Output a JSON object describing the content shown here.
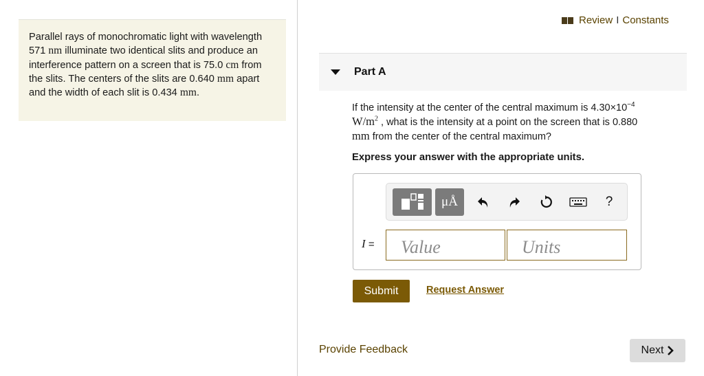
{
  "problem": {
    "seg1": "Parallel rays of monochromatic light with wavelength 571 ",
    "unit_nm": "nm",
    "seg2": " illuminate two identical slits and produce an interference pattern on a screen that is 75.0 ",
    "unit_cm": "cm",
    "seg3": " from the slits. The centers of the slits are 0.640 ",
    "unit_mm1": "mm",
    "seg4": " apart and the width of each slit is 0.434 ",
    "unit_mm2": "mm",
    "seg5": "."
  },
  "header": {
    "review": "Review",
    "separator": "I",
    "constants": "Constants"
  },
  "part": {
    "title": "Part A"
  },
  "question": {
    "q1": "If the intensity at the center of the central maximum is 4.30×10",
    "q_exp": "−4",
    "unit_w": "W/m",
    "unit_w_exp": "2",
    "q2": " , what is the intensity at a point on the screen that is 0.880",
    "unit_mm": "mm",
    "q3": " from the center of the central maximum?"
  },
  "instruction": "Express your answer with the appropriate units.",
  "toolbar": {
    "units_label": "μÅ",
    "help_label": "?"
  },
  "answer": {
    "variable": "I",
    "equals": "=",
    "value_placeholder": "Value",
    "units_placeholder": "Units"
  },
  "actions": {
    "submit": "Submit",
    "request_answer": "Request Answer",
    "provide_feedback": "Provide Feedback",
    "next": "Next"
  },
  "colors": {
    "accent": "#7b5a06",
    "problem_bg": "#f6f4e6"
  }
}
